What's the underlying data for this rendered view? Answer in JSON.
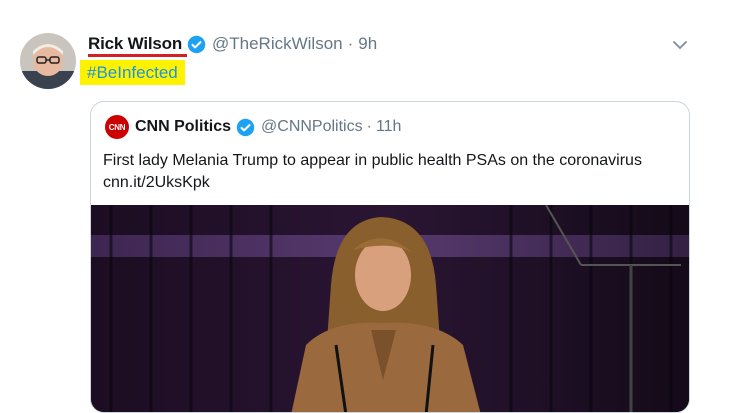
{
  "tweet": {
    "author_name": "Rick Wilson",
    "handle": "@TheRickWilson",
    "separator": "·",
    "time": "9h",
    "hashtag": "#BeInfected"
  },
  "quoted": {
    "author_name": "CNN Politics",
    "logo_text": "CNN",
    "handle": "@CNNPolitics",
    "separator": "·",
    "time": "11h",
    "text": "First lady Melania Trump to appear in public health PSAs on the coronavirus",
    "link": "cnn.it/2UksKpk"
  },
  "colors": {
    "link_blue": "#1b95e0",
    "highlight_yellow": "#fff200",
    "underline_red": "#d42020",
    "cnn_red": "#cc0000"
  },
  "icons": {
    "verified": "verified-badge-icon",
    "more": "chevron-down-icon"
  }
}
